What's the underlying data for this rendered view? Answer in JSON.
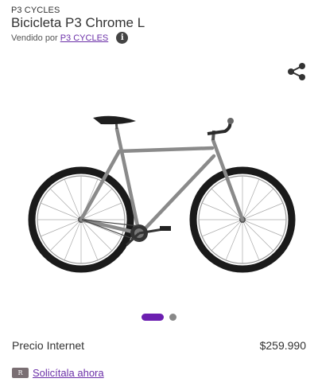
{
  "product": {
    "brand": "P3 CYCLES",
    "title": "Bicicleta P3 Chrome L",
    "seller_prefix": "Vendido por",
    "seller_name": "P3 CYCLES",
    "info_icon": "i"
  },
  "icons": {
    "share": "share-icon",
    "info": "info-icon",
    "card": "cmr-card-icon"
  },
  "carousel": {
    "total": 2,
    "active_index": 0
  },
  "price": {
    "label": "Precio Internet",
    "value": "$259.990"
  },
  "cmr": {
    "card_text": "R",
    "link_text": "Solicítala ahora"
  },
  "colors": {
    "accent": "#6c1fb0",
    "link": "#6b2fa8"
  }
}
